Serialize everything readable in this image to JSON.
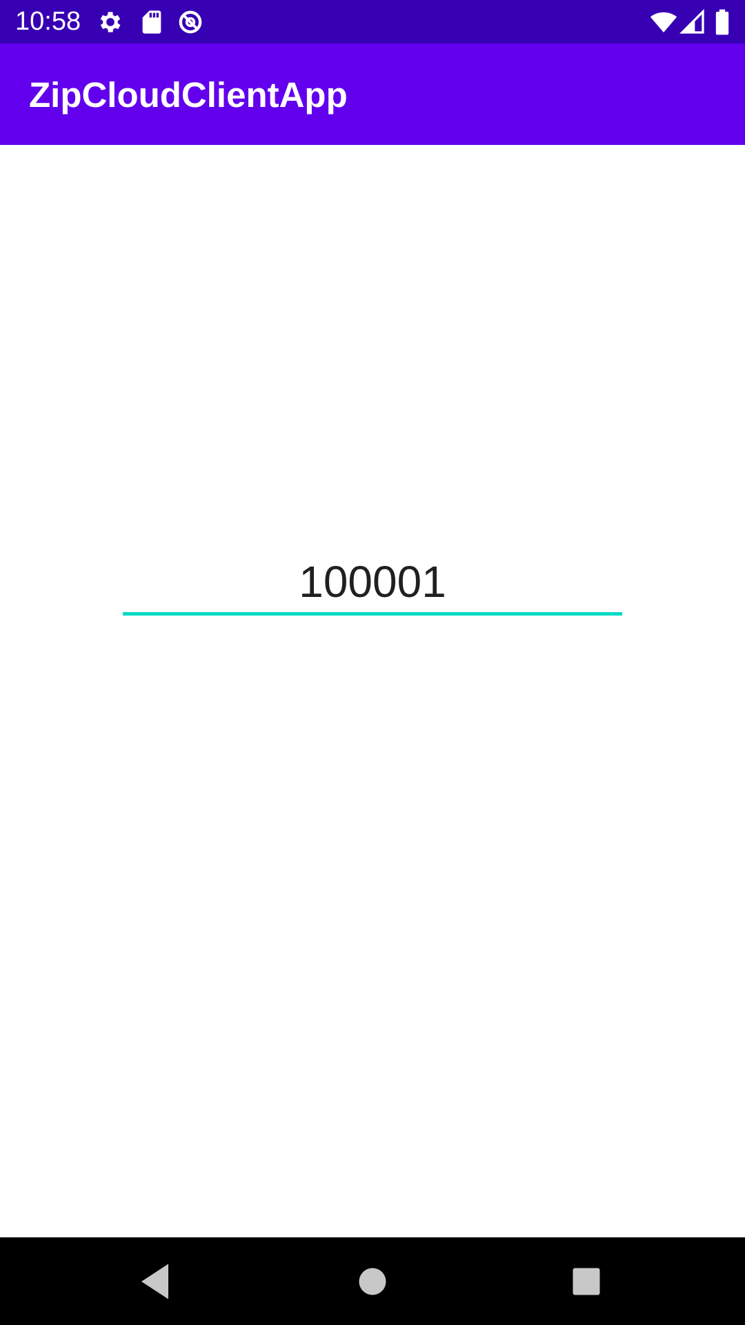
{
  "status_bar": {
    "time": "10:58",
    "background": "#3700b3",
    "icons_left": [
      "gear-icon",
      "sd-card-icon",
      "data-saver-icon"
    ],
    "icons_right": [
      "wifi-icon",
      "cellular-signal-icon",
      "battery-icon"
    ]
  },
  "app_bar": {
    "title": "ZipCloudClientApp",
    "background": "#6200ee"
  },
  "main": {
    "zip_input": {
      "value": "100001",
      "underline_color": "#03dac5"
    }
  },
  "nav_bar": {
    "buttons": [
      "back-icon",
      "home-icon",
      "recents-icon"
    ]
  }
}
